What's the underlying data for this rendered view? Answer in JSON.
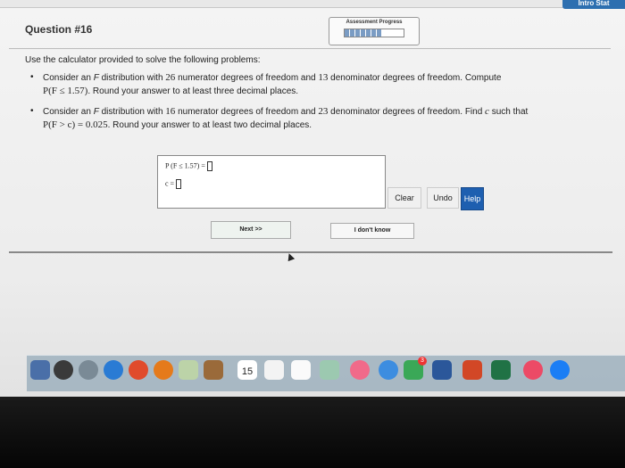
{
  "topbar": {
    "intro_stat": "Intro Stat"
  },
  "header": {
    "question_title": "Question #16",
    "progress_label": "Assessment Progress",
    "progress_fraction": 0.62
  },
  "content": {
    "intro": "Use the calculator provided to solve the following problems:",
    "problem1": {
      "text_a": "Consider an ",
      "F1": "F",
      "text_b": " distribution with ",
      "num_df": "26",
      "text_c": " numerator degrees of freedom and ",
      "den_df": "13",
      "text_d": " denominator degrees of freedom. Compute",
      "expr": "P(F ≤ 1.57)",
      "text_e": ". Round your answer to at least three decimal places."
    },
    "problem2": {
      "text_a": "Consider an ",
      "F1": "F",
      "text_b": " distribution with ",
      "num_df": "16",
      "text_c": " numerator degrees of freedom and ",
      "den_df": "23",
      "text_d": " denominator degrees of freedom. Find ",
      "c": "c",
      "text_e": " such that",
      "expr": "P(F > c) = 0.025",
      "text_f": ". Round your answer to at least two decimal places."
    }
  },
  "answer_panel": {
    "row1_label": "P (F ≤ 1.57) =",
    "row2_label": "c ="
  },
  "buttons": {
    "clear": "Clear",
    "undo": "Undo",
    "help": "Help",
    "next": "Next >>",
    "idk": "I don't know"
  },
  "dock": {
    "calendar_day": "15",
    "badge": "3"
  },
  "colors": {
    "help_button": "#1e5fb0",
    "intro_stat_tab": "#2d6fb0"
  }
}
